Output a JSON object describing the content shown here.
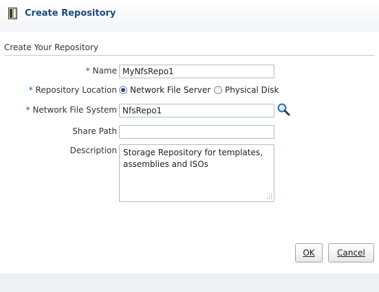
{
  "dialog": {
    "title": "Create Repository",
    "icon": "repository-icon"
  },
  "section": {
    "title": "Create Your Repository"
  },
  "form": {
    "required_marker": "*",
    "name": {
      "label": "Name",
      "value": "MyNfsRepo1"
    },
    "repository_location": {
      "label": "Repository Location",
      "options": [
        {
          "label": "Network File Server",
          "selected": true
        },
        {
          "label": "Physical Disk",
          "selected": false
        }
      ]
    },
    "network_file_system": {
      "label": "Network File System",
      "value": "NfsRepo1",
      "search_icon": "search-icon"
    },
    "share_path": {
      "label": "Share Path",
      "value": ""
    },
    "description": {
      "label": "Description",
      "value": "Storage Repository for templates, assemblies and ISOs"
    }
  },
  "buttons": {
    "ok": "OK",
    "cancel": "Cancel"
  },
  "colors": {
    "title": "#1c4a7f",
    "required": "#0a5da8",
    "footer": "#eef0f3"
  }
}
